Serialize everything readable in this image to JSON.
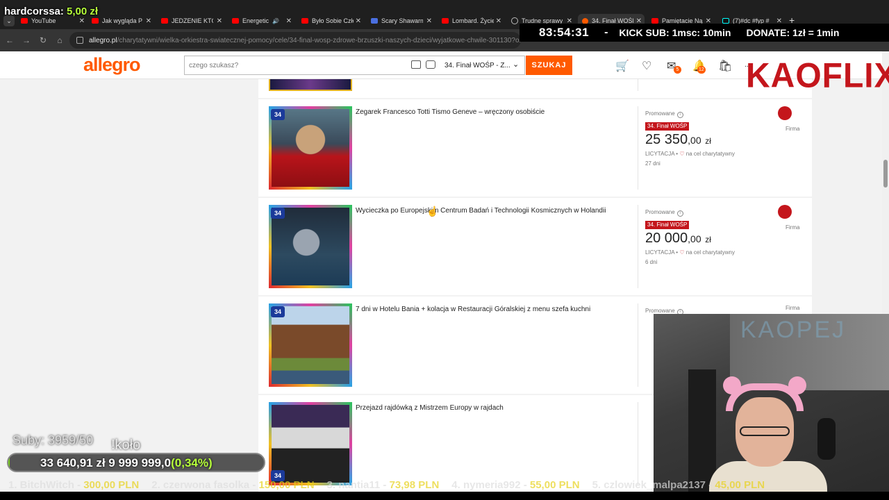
{
  "donation_alert": {
    "donor": "hardcorssa:",
    "amount": "5,00 zł"
  },
  "browser": {
    "tabs": [
      {
        "title": "YouTube",
        "icon": "youtube-icon"
      },
      {
        "title": "Jak wygląda P",
        "icon": "youtube-icon"
      },
      {
        "title": "JEDZENIE KTÓ",
        "icon": "youtube-icon"
      },
      {
        "title": "Energetic",
        "icon": "youtube-icon"
      },
      {
        "title": "Było Sobie Czło",
        "icon": "youtube-icon"
      },
      {
        "title": "Scary Shawarm",
        "icon": "document-icon"
      },
      {
        "title": "Lombard. Życie",
        "icon": "youtube-icon"
      },
      {
        "title": "Trudne sprawy",
        "icon": "globe-icon"
      },
      {
        "title": "34. Finał WOŚP",
        "icon": "allegro-icon"
      },
      {
        "title": "Pamiętacie Ną",
        "icon": "youtube-icon"
      },
      {
        "title": "(7)#dc #fyp #",
        "icon": "tiktok-icon"
      }
    ],
    "url_domain": "allegro.pl",
    "url_path": "/charytatywni/wielka-orkiestra-swiatecznej-pomocy/cele/34-final-wosp-zdrowe-brzuszki-naszych-dzieci/wyjatkowe-chwile-301130?order=pd"
  },
  "stream_overlay": {
    "timer": "83:54:31",
    "sep": "-",
    "sub_info": "KICK SUB: 1msc: 10min",
    "donate_info": "DONATE: 1zł = 1min",
    "logo": "KAOFLIX",
    "subs": "Suby: 3959/50",
    "kolo": "!koło",
    "goal_text": "33 640,91 zł  9 999 999,0",
    "goal_pct": "(0,34%)",
    "goal_fraction": 0.0034,
    "ticker": [
      {
        "name": "1. BitchWitch - ",
        "value": "300,00 PLN"
      },
      {
        "name": "2. czerwona fasolka - ",
        "value": "150,00 PLN"
      },
      {
        "name": "3. nantia11 - ",
        "value": "73,98 PLN"
      },
      {
        "name": "4. nymeria992 - ",
        "value": "55,00 PLN"
      },
      {
        "name": "5. czlowiek_malpa2137 - ",
        "value": "45,00 PLN"
      }
    ],
    "webcam_neon": "KAOPEJ"
  },
  "site": {
    "logo": "allegro",
    "search_placeholder": "czego szukasz?",
    "category": "34. Finał WOŚP - Z...",
    "search_button": "SZUKAJ",
    "badges": {
      "notifications": "5",
      "messages": "12"
    },
    "user_label": "..."
  },
  "items": [
    {
      "title": "Zegarek Francesco Totti Tismo Geneve – wręczony osobiście",
      "promo": "Promowane",
      "tag": "34. Finał WOŚP",
      "price_int": "25 350",
      "price_dec": ",00",
      "currency": "zł",
      "auction": "LICYTACJA •",
      "charity": "na cel charytatywny",
      "days": "27 dni",
      "seller": "Firma"
    },
    {
      "title": "Wycieczka po Europejskim Centrum Badań i Technologii Kosmicznych w Holandii",
      "promo": "Promowane",
      "tag": "34. Finał WOŚP",
      "price_int": "20 000",
      "price_dec": ",00",
      "currency": "zł",
      "auction": "LICYTACJA •",
      "charity": "na cel charytatywny",
      "days": "6 dni",
      "seller": "Firma"
    },
    {
      "title": "7 dni w Hotelu Bania + kolacja w Restauracji Góralskiej z menu szefa kuchni",
      "promo": "Promowane",
      "seller": "Firma"
    },
    {
      "title": "Przejazd rajdówką z Mistrzem Europy w rajdach"
    }
  ],
  "thumb_badge": "34"
}
